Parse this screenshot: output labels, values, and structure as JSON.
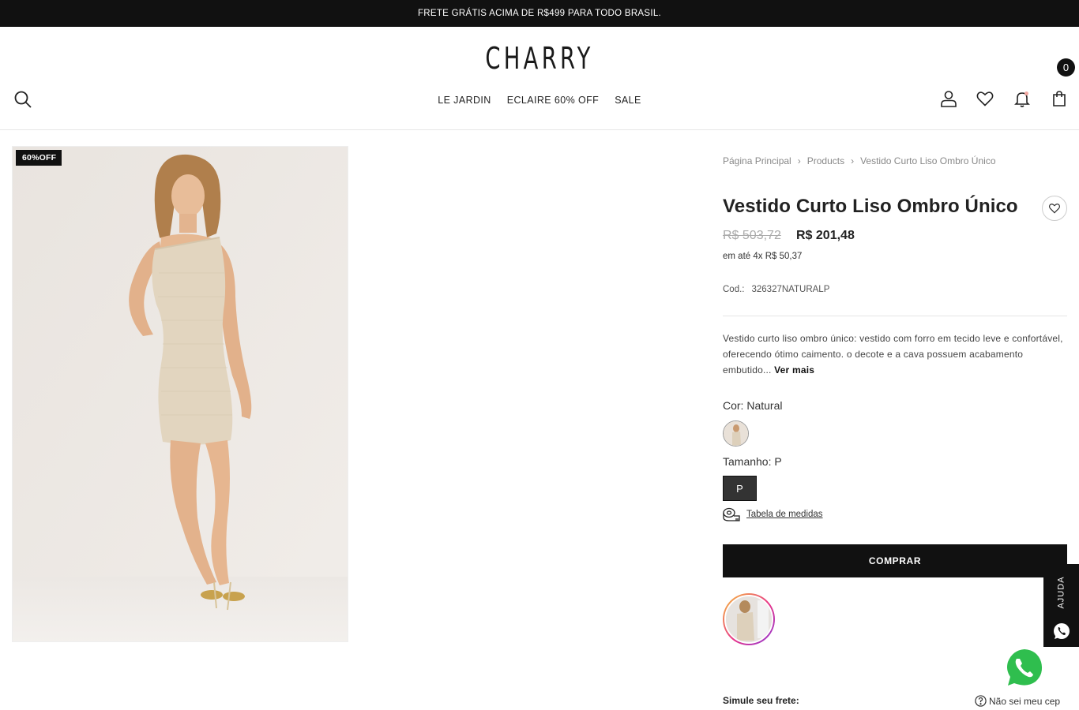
{
  "announcement": "FRETE GRÁTIS ACIMA DE R$499 PARA TODO BRASIL.",
  "header": {
    "logo": "CHARRY",
    "nav": [
      "LE JARDIN",
      "ECLAIRE 60% OFF",
      "SALE"
    ],
    "cart_count": "0",
    "icons": [
      "search-icon",
      "user-icon",
      "heart-icon",
      "bell-icon",
      "bag-icon"
    ]
  },
  "gallery": {
    "badge": "60%OFF"
  },
  "breadcrumb": [
    "Página Principal",
    "Products",
    "Vestido Curto Liso Ombro Único"
  ],
  "product": {
    "title": "Vestido Curto Liso Ombro Único",
    "price_old": "R$ 503,72",
    "price_new": "R$ 201,48",
    "installments": "em até 4x R$ 50,37",
    "sku_label": "Cod.:",
    "sku": "326327NATURALP",
    "description": "Vestido curto liso ombro único: vestido com forro em tecido leve e confortável, oferecendo ótimo caimento. o decote e a cava possuem acabamento embutido...",
    "read_more": "Ver mais",
    "color_label": "Cor: Natural",
    "size_label": "Tamanho: P",
    "sizes": [
      "P"
    ],
    "size_chart": "Tabela de medidas",
    "buy_button": "COMPRAR"
  },
  "help_tab": "AJUDA",
  "shipping": {
    "label": "Simule seu frete:",
    "help_link": "Não sei meu cep"
  },
  "colors": {
    "accent": "#111111",
    "price_old": "#aaaaaa",
    "badge_bg": "#111111"
  }
}
